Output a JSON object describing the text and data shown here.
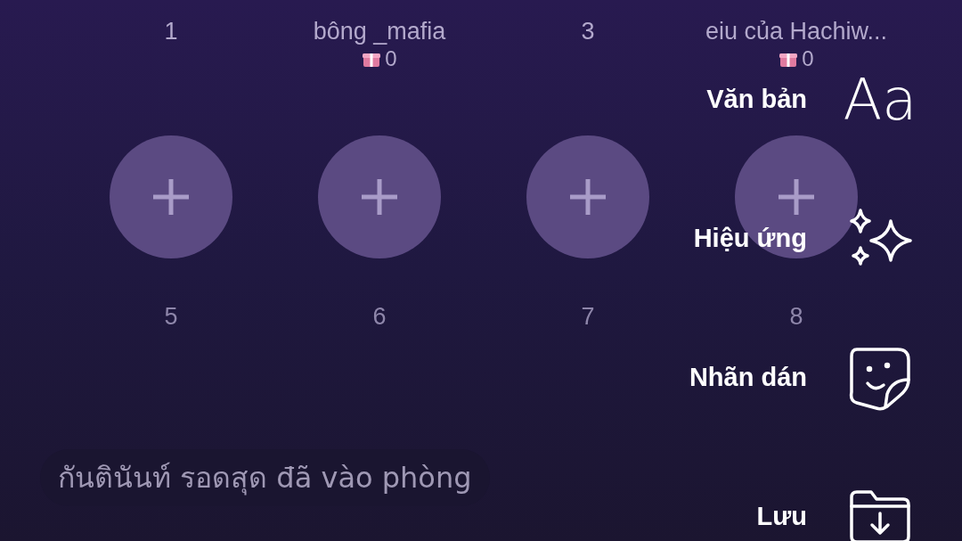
{
  "seats_row_1": [
    {
      "label": "1"
    },
    {
      "label": "bông _mafia",
      "gifts": "0"
    },
    {
      "label": "3"
    },
    {
      "label": "eiu của Hachiw...",
      "gifts": "0"
    }
  ],
  "seats_row_2": [
    {
      "label": "5"
    },
    {
      "label": "6"
    },
    {
      "label": "7"
    },
    {
      "label": "8"
    }
  ],
  "messages": [
    "กันตินันท์ รอดสุด đã vào phòng"
  ],
  "menu": [
    {
      "kind": "text",
      "label": "Văn bản",
      "glyph": "Aa"
    },
    {
      "kind": "effects",
      "label": "Hiệu ứng"
    },
    {
      "kind": "sticker",
      "label": "Nhãn dán"
    },
    {
      "kind": "save",
      "label": "Lưu"
    }
  ]
}
